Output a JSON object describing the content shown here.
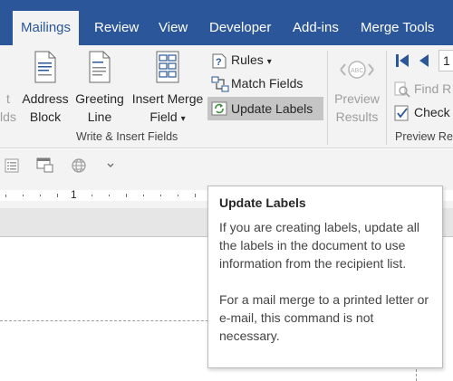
{
  "tabs": [
    {
      "label": "Mailings",
      "active": true
    },
    {
      "label": "Review"
    },
    {
      "label": "View"
    },
    {
      "label": "Developer"
    },
    {
      "label": "Add-ins"
    },
    {
      "label": "Merge Tools"
    }
  ],
  "ribbon": {
    "cut_left": {
      "line1": "t",
      "line2": "lds"
    },
    "address_block": {
      "line1": "Address",
      "line2": "Block"
    },
    "greeting_line": {
      "line1": "Greeting",
      "line2": "Line"
    },
    "insert_merge_field": {
      "line1": "Insert Merge",
      "line2": "Field",
      "arrow": "▾"
    },
    "rules": {
      "label": "Rules",
      "arrow": "▾"
    },
    "match_fields": {
      "label": "Match Fields"
    },
    "update_labels": {
      "label": "Update Labels"
    },
    "group_write_insert": "Write & Insert Fields",
    "preview_results": {
      "line1": "Preview",
      "line2": "Results"
    },
    "record_number": "1",
    "find_recipient": "Find R",
    "check_errors": "Check",
    "group_preview": "Preview Re"
  },
  "ruler": {
    "number": "1"
  },
  "tooltip": {
    "title": "Update Labels",
    "p1": "If you are creating labels, update all the labels in the document to use information from the recipient list.",
    "p2": "For a mail merge to a printed letter or e-mail, this command is not necessary."
  },
  "colors": {
    "title_bar": "#2b579a",
    "ribbon_bg": "#f3f3f3",
    "highlight": "#c5c5c5"
  }
}
